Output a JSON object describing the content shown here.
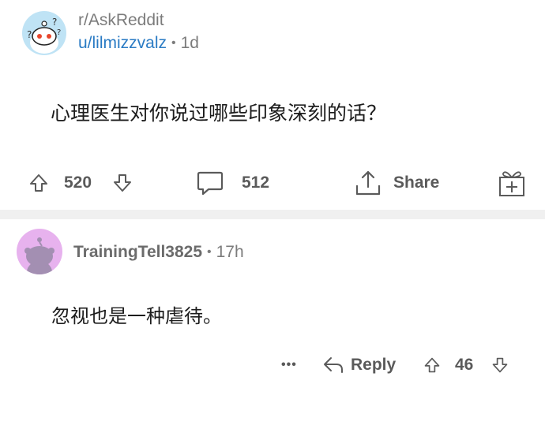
{
  "post": {
    "subreddit": "r/AskReddit",
    "username": "u/lilmizzvalz",
    "separator": "•",
    "age": "1d",
    "title": "心理医生对你说过哪些印象深刻的话？",
    "avatar_icon": "snoo-confused-icon"
  },
  "post_actions": {
    "upvote_icon": "upvote-arrow-icon",
    "score": "520",
    "downvote_icon": "downvote-arrow-icon",
    "comment_icon": "comment-bubble-icon",
    "comments": "512",
    "share_icon": "share-icon",
    "share_label": "Share",
    "award_icon": "gift-icon"
  },
  "comment": {
    "username": "TrainingTell3825",
    "separator": "•",
    "age": "17h",
    "body": "忽视也是一种虐待。",
    "avatar_icon": "snoo-avatar-icon",
    "more_label": "•••",
    "reply_label": "Reply",
    "score": "46"
  },
  "colors": {
    "link": "#2a7bc4",
    "muted": "#7c7c7c",
    "avatar_post_bg": "#bfe3f5",
    "avatar_comment_bg": "#e7b2ee",
    "divider": "#f0f0f0"
  }
}
